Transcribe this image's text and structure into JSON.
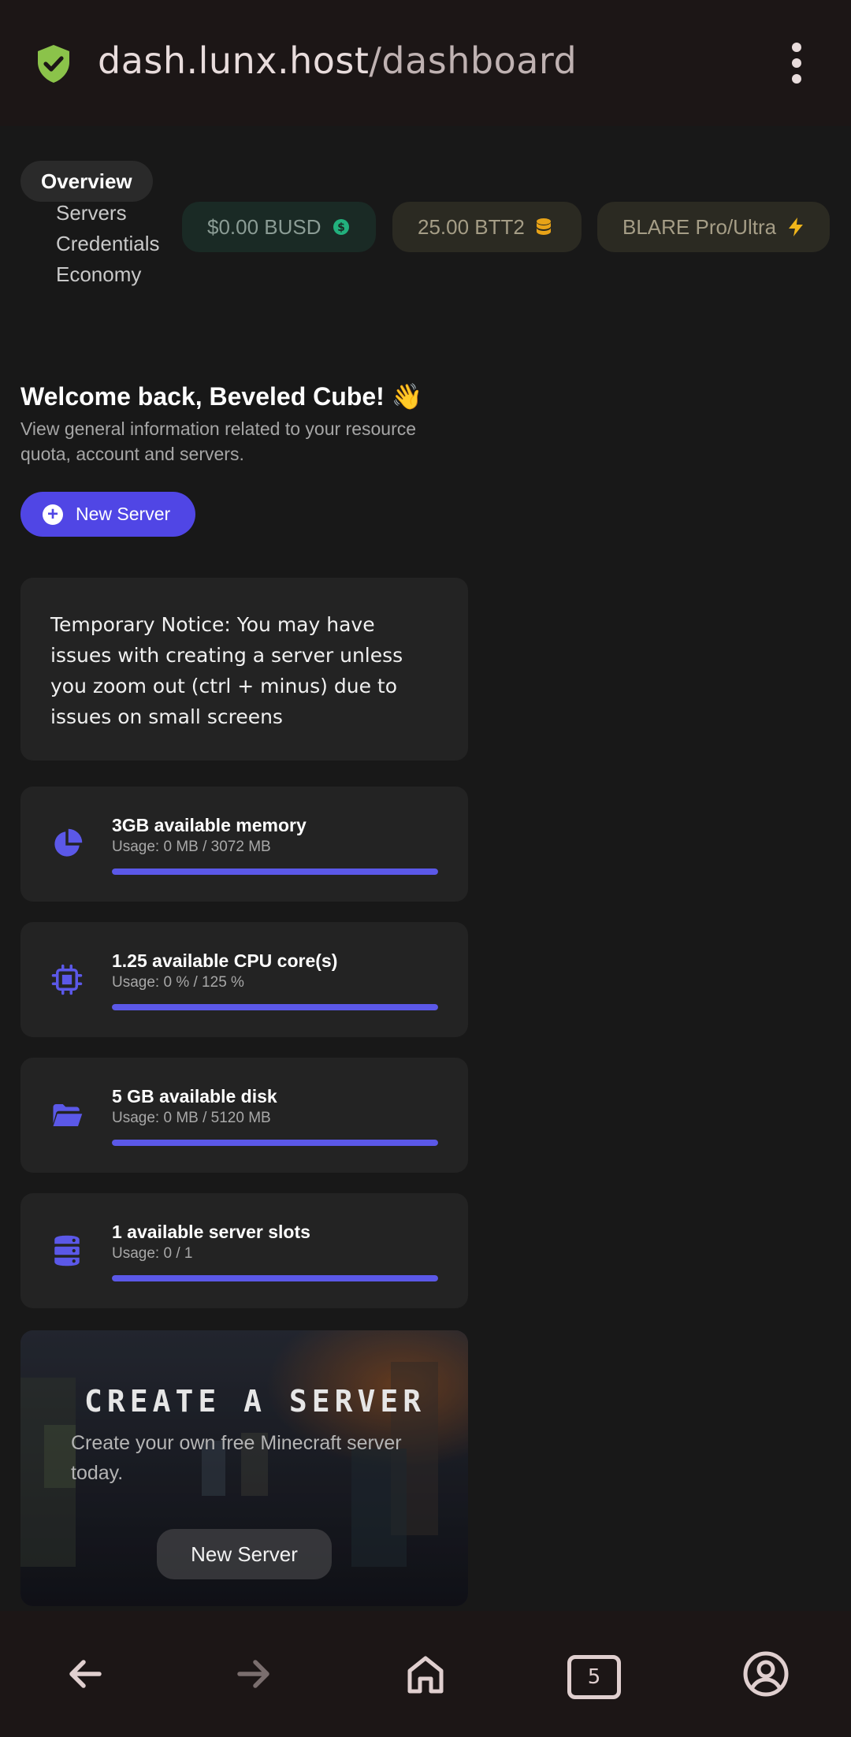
{
  "browser": {
    "url_host": "dash.lunx.host",
    "url_path": "/dashboard",
    "tab_count": "5"
  },
  "nav": {
    "active": "Overview",
    "items": [
      "Servers",
      "Credentials",
      "Economy"
    ]
  },
  "balances": {
    "busd": "$0.00 BUSD",
    "btt2": "25.00 BTT2",
    "plan": "BLARE Pro/Ultra"
  },
  "welcome": {
    "title": "Welcome back, Beveled Cube! 👋",
    "subtitle": "View general information related to your resource quota, account and servers.",
    "new_server": "New Server"
  },
  "notice": "Temporary Notice: You may have issues with creating a server unless you zoom out (ctrl + minus) due to issues on small screens",
  "stats": [
    {
      "icon": "pie-chart-icon",
      "title": "3GB available memory",
      "usage": "Usage: 0 MB / 3072 MB",
      "fill": 1.0
    },
    {
      "icon": "cpu-icon",
      "title": "1.25 available CPU core(s)",
      "usage": "Usage: 0 % / 125 %",
      "fill": 1.0
    },
    {
      "icon": "folder-icon",
      "title": "5 GB available disk",
      "usage": "Usage: 0 MB / 5120 MB",
      "fill": 1.0
    },
    {
      "icon": "server-icon",
      "title": "1 available server slots",
      "usage": "Usage: 0 / 1",
      "fill": 1.0
    }
  ],
  "promo": {
    "title": "CREATE A SERVER",
    "subtitle": "Create your own free Minecraft server today.",
    "button": "New Server"
  },
  "colors": {
    "accent": "#5046e5",
    "bar": "#5b58e8",
    "shield": "#8bc34a"
  }
}
